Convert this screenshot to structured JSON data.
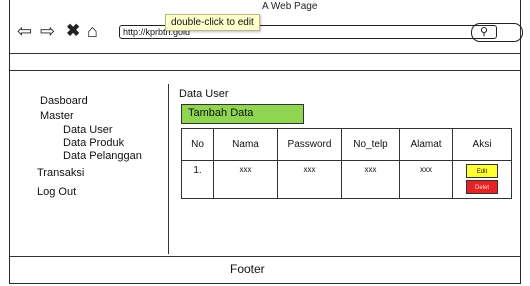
{
  "window": {
    "title": "A Web Page"
  },
  "browser": {
    "url": "http://kprbtn.gold",
    "icons": [
      "back-arrow-icon",
      "forward-arrow-icon",
      "close-icon",
      "home-icon",
      "search-icon"
    ],
    "tooltip": "double-click to edit"
  },
  "sidebar": {
    "items": [
      {
        "label": "Dasboard"
      },
      {
        "label": "Master"
      },
      {
        "label": "Data User"
      },
      {
        "label": "Data Produk"
      },
      {
        "label": "Data Pelanggan"
      },
      {
        "label": "Transaksi"
      },
      {
        "label": "Log Out"
      }
    ]
  },
  "main": {
    "title": "Data User",
    "add_button": "Tambah Data",
    "table": {
      "headers": [
        "No",
        "Nama",
        "Password",
        "No_telp",
        "Alamat",
        "Aksi"
      ],
      "rows": [
        {
          "no": "1.",
          "nama": "xxx",
          "password": "xxx",
          "no_telp": "xxx",
          "alamat": "xxx",
          "edit": "Edit",
          "delete": "Delet"
        }
      ]
    }
  },
  "footer": {
    "text": "Footer"
  },
  "colors": {
    "add_button": "#8fd552",
    "edit_button": "#ffff33",
    "delete_button": "#e82222",
    "tooltip": "#ffffcc"
  }
}
